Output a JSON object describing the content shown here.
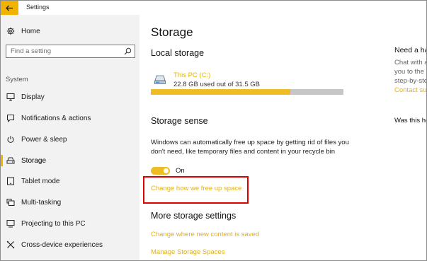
{
  "window": {
    "title": "Settings"
  },
  "colors": {
    "accent": "#f0b400",
    "link": "#e0b020",
    "highlight": "#e00000"
  },
  "sidebar": {
    "home_label": "Home",
    "search_placeholder": "Find a setting",
    "section_label": "System",
    "items": [
      {
        "label": "Display",
        "icon": "display-icon"
      },
      {
        "label": "Notifications & actions",
        "icon": "notifications-icon"
      },
      {
        "label": "Power & sleep",
        "icon": "power-icon"
      },
      {
        "label": "Storage",
        "icon": "storage-icon",
        "active": true
      },
      {
        "label": "Tablet mode",
        "icon": "tablet-icon"
      },
      {
        "label": "Multi-tasking",
        "icon": "multitasking-icon"
      },
      {
        "label": "Projecting to this PC",
        "icon": "projecting-icon"
      },
      {
        "label": "Cross-device experiences",
        "icon": "cross-device-icon"
      }
    ]
  },
  "main": {
    "title": "Storage",
    "local_storage": {
      "heading": "Local storage",
      "drive_name": "This PC (C:)",
      "usage_text": "22.8 GB used out of 31.5 GB",
      "used_fraction": 0.724
    },
    "storage_sense": {
      "heading": "Storage sense",
      "description": "Windows can automatically free up space by getting rid of files you don't need, like temporary files and content in your recycle bin",
      "toggle_label": "On",
      "toggle_on": true,
      "link": "Change how we free up space"
    },
    "more": {
      "heading": "More storage settings",
      "links": [
        "Change where new content is saved",
        "Manage Storage Spaces"
      ]
    }
  },
  "right_panel": {
    "heading": "Need a ha",
    "lines": [
      "Chat with a",
      "you to the ",
      "step-by-ste"
    ],
    "contact_link": "Contact su",
    "feedback": "Was this he"
  }
}
